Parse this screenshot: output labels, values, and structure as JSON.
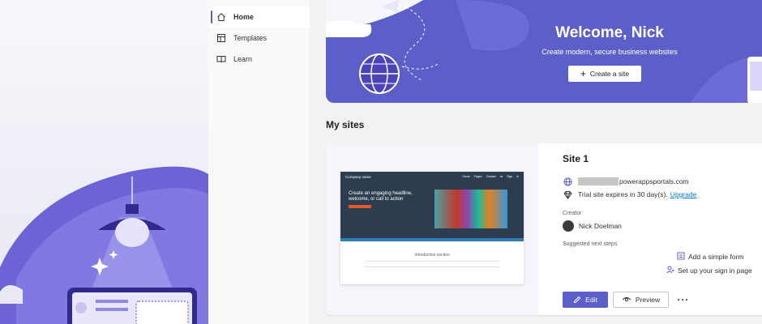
{
  "nav": {
    "items": [
      {
        "label": "Home",
        "icon": "home-icon",
        "active": true
      },
      {
        "label": "Templates",
        "icon": "templates-icon",
        "active": false
      },
      {
        "label": "Learn",
        "icon": "book-icon",
        "active": false
      }
    ]
  },
  "hero": {
    "title": "Welcome, Nick",
    "subtitle": "Create modern, secure business websites",
    "create_label": "Create a site"
  },
  "my_sites": {
    "title": "My sites"
  },
  "site": {
    "name": "Site 1",
    "url_suffix": "powerappsportals.com",
    "trial_text": "Trial site expires in 30 day(s).",
    "upgrade_label": "Upgrade",
    "creator_label": "Creator",
    "creator_name": "Nick Doelman",
    "next_steps_label": "Suggested next steps",
    "steps": [
      "Add a simple form",
      "Set up your sign in page"
    ],
    "edit_label": "Edit",
    "preview_label": "Preview",
    "more_label": "···",
    "thumbnail": {
      "logo": "Company name",
      "nav": "Home Pages Contact us Sign in",
      "headline": "Create an engaging headline, welcome, or call to action",
      "intro": "Introduction section"
    }
  },
  "colors": {
    "accent": "#5b5fc7",
    "link": "#0078d4"
  }
}
